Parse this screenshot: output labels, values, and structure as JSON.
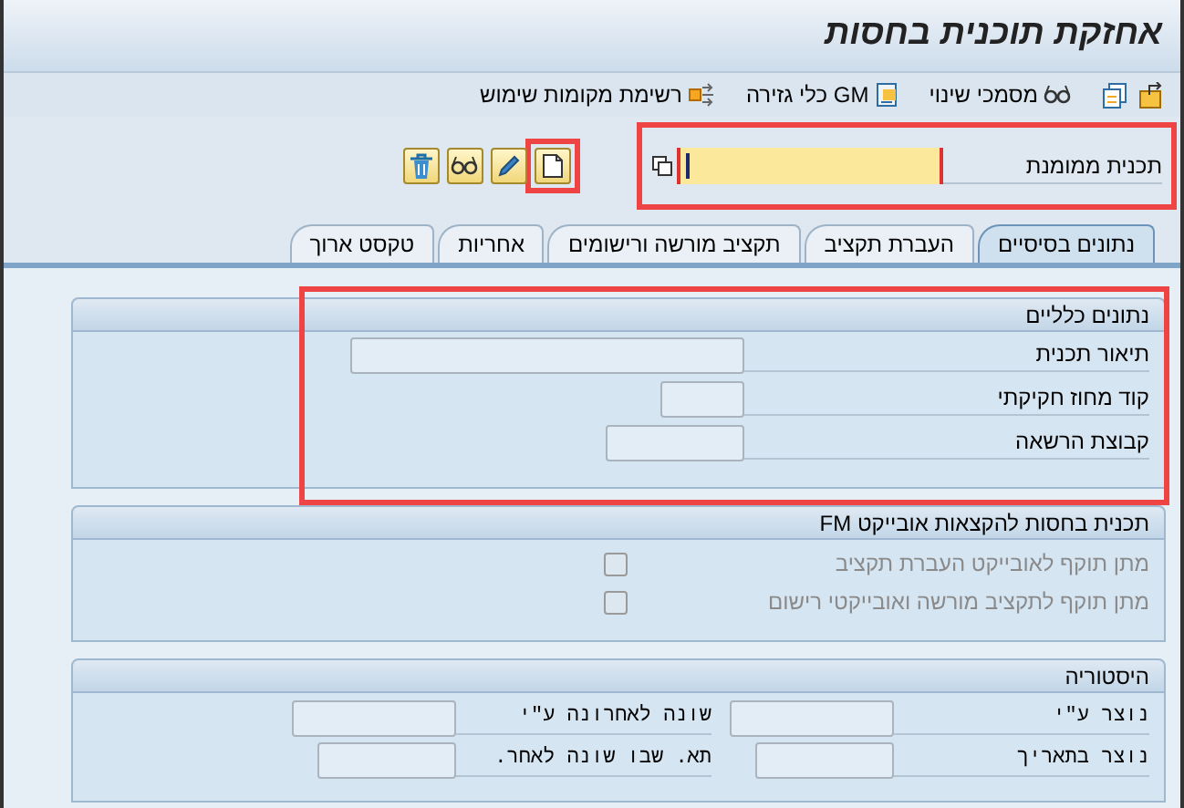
{
  "window": {
    "title": "אחזקת תוכנית בחסות"
  },
  "toolbar": [
    {
      "label": "מסמכי שינוי"
    },
    {
      "label": "GM כלי גזירה"
    },
    {
      "label": "רשימת מקומות שימוש"
    }
  ],
  "plan_field": {
    "label": "תכנית ממומנת",
    "highlighted": true,
    "focused": true
  },
  "action_buttons": [
    {
      "highlighted": true
    },
    {
      "highlighted": false
    },
    {
      "highlighted": false
    },
    {
      "highlighted": false
    }
  ],
  "tabs": [
    {
      "label": "נתונים בסיסיים",
      "selected": true
    },
    {
      "label": "העברת תקציב",
      "selected": false
    },
    {
      "label": "תקציב מורשה ורישומים",
      "selected": false
    },
    {
      "label": "אחריות",
      "selected": false
    },
    {
      "label": "טקסט ארוך",
      "selected": false
    }
  ],
  "sections": [
    {
      "kind": "fields",
      "title": "נתונים כלליים",
      "highlighted": true,
      "fields": [
        {
          "label": "תיאור תכנית"
        },
        {
          "label": "קוד מחוז חקיקתי"
        },
        {
          "label": "קבוצת הרשאה"
        }
      ]
    },
    {
      "kind": "checkboxes",
      "title": "תכנית בחסות להקצאות אובייקט FM",
      "highlighted": false,
      "rows": [
        {
          "label": "מתן תוקף לאובייקט העברת תקציב",
          "checked": false,
          "disabled": true
        },
        {
          "label": "מתן תוקף לתקציב מורשה ואובייקטי רישום",
          "checked": false,
          "disabled": true
        }
      ]
    },
    {
      "kind": "history",
      "title": "היסטוריה",
      "highlighted": false,
      "fields": [
        {
          "label": "נוצר ע\"י"
        },
        {
          "label": "שונה לאחרונה ע\"י"
        },
        {
          "label": "נוצר בתאריך"
        },
        {
          "label": "תא. שבו שונה לאחר."
        }
      ]
    }
  ]
}
